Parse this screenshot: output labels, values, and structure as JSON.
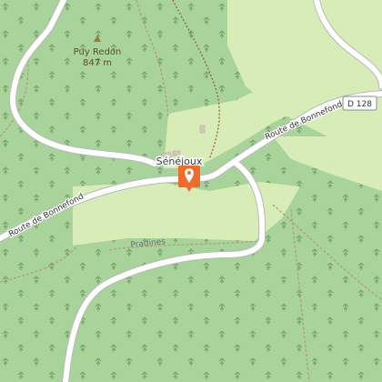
{
  "map": {
    "peak": {
      "name": "Puy Redon",
      "elevation": "847 m"
    },
    "village": "Sénéjoux",
    "hamlet": "Pradines",
    "roads": {
      "west": "Route de Bonnefond",
      "east": "Route de Bonnefond",
      "route_ref": "D 128"
    },
    "marker": {
      "type": "location-pin"
    },
    "colors": {
      "forest": "#a8d39a",
      "meadow": "#d8ecb7",
      "road": "#ffffff",
      "road_casing": "#b9b9b9",
      "track": "#9a8a6a",
      "marker": "#f26b2a"
    }
  }
}
